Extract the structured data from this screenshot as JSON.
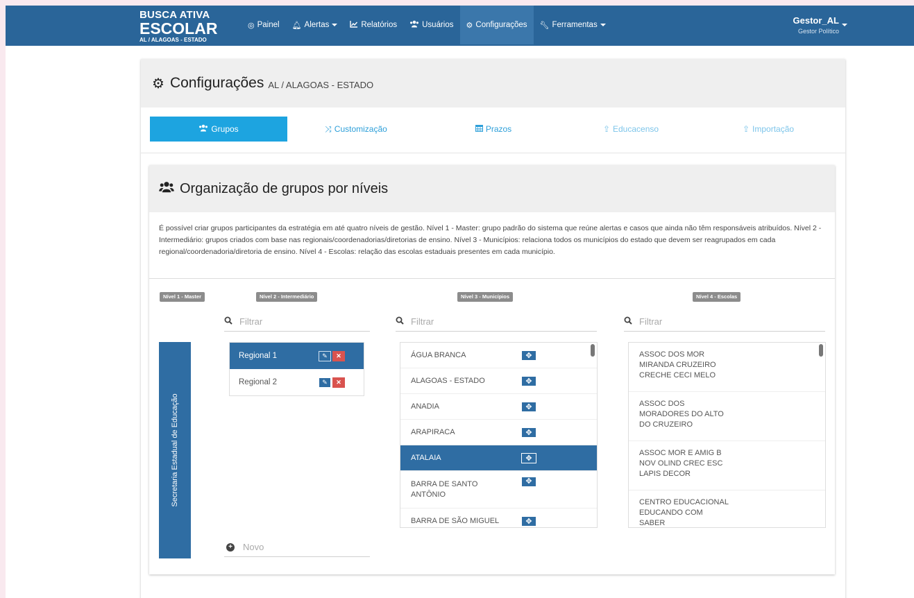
{
  "brand": {
    "line1": "BUSCA ATIVA",
    "line2": "ESCOLAR",
    "line3": "AL / ALAGOAS - ESTADO"
  },
  "nav": [
    {
      "label": "Painel",
      "icon": "dashboard-icon",
      "active": false,
      "dropdown": false
    },
    {
      "label": "Alertas",
      "icon": "bell-icon",
      "active": false,
      "dropdown": true
    },
    {
      "label": "Relatórios",
      "icon": "line-chart-icon",
      "active": false,
      "dropdown": false
    },
    {
      "label": "Usuários",
      "icon": "users-icon",
      "active": false,
      "dropdown": false
    },
    {
      "label": "Configurações",
      "icon": "gear-icon",
      "active": true,
      "dropdown": false
    },
    {
      "label": "Ferramentas",
      "icon": "wrench-icon",
      "active": false,
      "dropdown": true
    }
  ],
  "user": {
    "name": "Gestor_AL",
    "role": "Gestor Político"
  },
  "page": {
    "title": "Configurações",
    "subtitle": "AL / ALAGOAS - ESTADO"
  },
  "tabs": [
    {
      "label": "Grupos",
      "icon": "users-icon",
      "active": true
    },
    {
      "label": "Customização",
      "icon": "shuffle-icon",
      "active": false
    },
    {
      "label": "Prazos",
      "icon": "calendar-icon",
      "active": false
    },
    {
      "label": "Educacenso",
      "icon": "upload-icon",
      "active": false
    },
    {
      "label": "Importação",
      "icon": "upload-icon",
      "active": false
    }
  ],
  "section": {
    "title": "Organização de grupos por níveis",
    "description": "É possível criar grupos participantes da estratégia em até quatro níveis de gestão. Nível 1 - Master: grupo padrão do sistema que reúne alertas e casos que ainda não têm responsáveis atribuídos. Nível 2 - Intermediário: grupos criados com base nas regionais/coordenadorias/diretorias de ensino. Nível 3 - Municípios: relaciona todos os municípios do estado que devem ser reagrupados em cada regional/coordenadoria/diretoria de ensino. Nível 4 - Escolas: relação das escolas estaduais presentes em cada município."
  },
  "levels": {
    "l1": "Nível 1 - Master",
    "l2": "Nível 2 - Intermediário",
    "l3": "Nível 3 - Municípios",
    "l4": "Nível 4 - Escolas"
  },
  "filter_placeholder": "Filtrar",
  "master_group": "Secretaria Estadual de Educação",
  "regionals": [
    {
      "name": "Regional 1",
      "selected": true
    },
    {
      "name": "Regional 2",
      "selected": false
    }
  ],
  "new_placeholder": "Novo",
  "municipios": [
    {
      "name": "ÁGUA BRANCA",
      "selected": false
    },
    {
      "name": "ALAGOAS - ESTADO",
      "selected": false
    },
    {
      "name": "ANADIA",
      "selected": false
    },
    {
      "name": "ARAPIRACA",
      "selected": false
    },
    {
      "name": "ATALAIA",
      "selected": true
    },
    {
      "name": "BARRA DE SANTO ANTÔNIO",
      "selected": false
    },
    {
      "name": "BARRA DE SÃO MIGUEL",
      "selected": false
    }
  ],
  "escolas": [
    "ASSOC DOS MOR MIRANDA CRUZEIRO CRECHE CECI MELO",
    "ASSOC DOS MORADORES DO ALTO DO CRUZEIRO",
    "ASSOC MOR E AMIG B NOV OLIND CREC ESC LAPIS DECOR",
    "CENTRO EDUCACIONAL EDUCANDO COM SABER"
  ],
  "colors": {
    "navbar": "#2a6599",
    "accent": "#1da4e0",
    "selected": "#2f6da3",
    "delete": "#d9534f"
  }
}
